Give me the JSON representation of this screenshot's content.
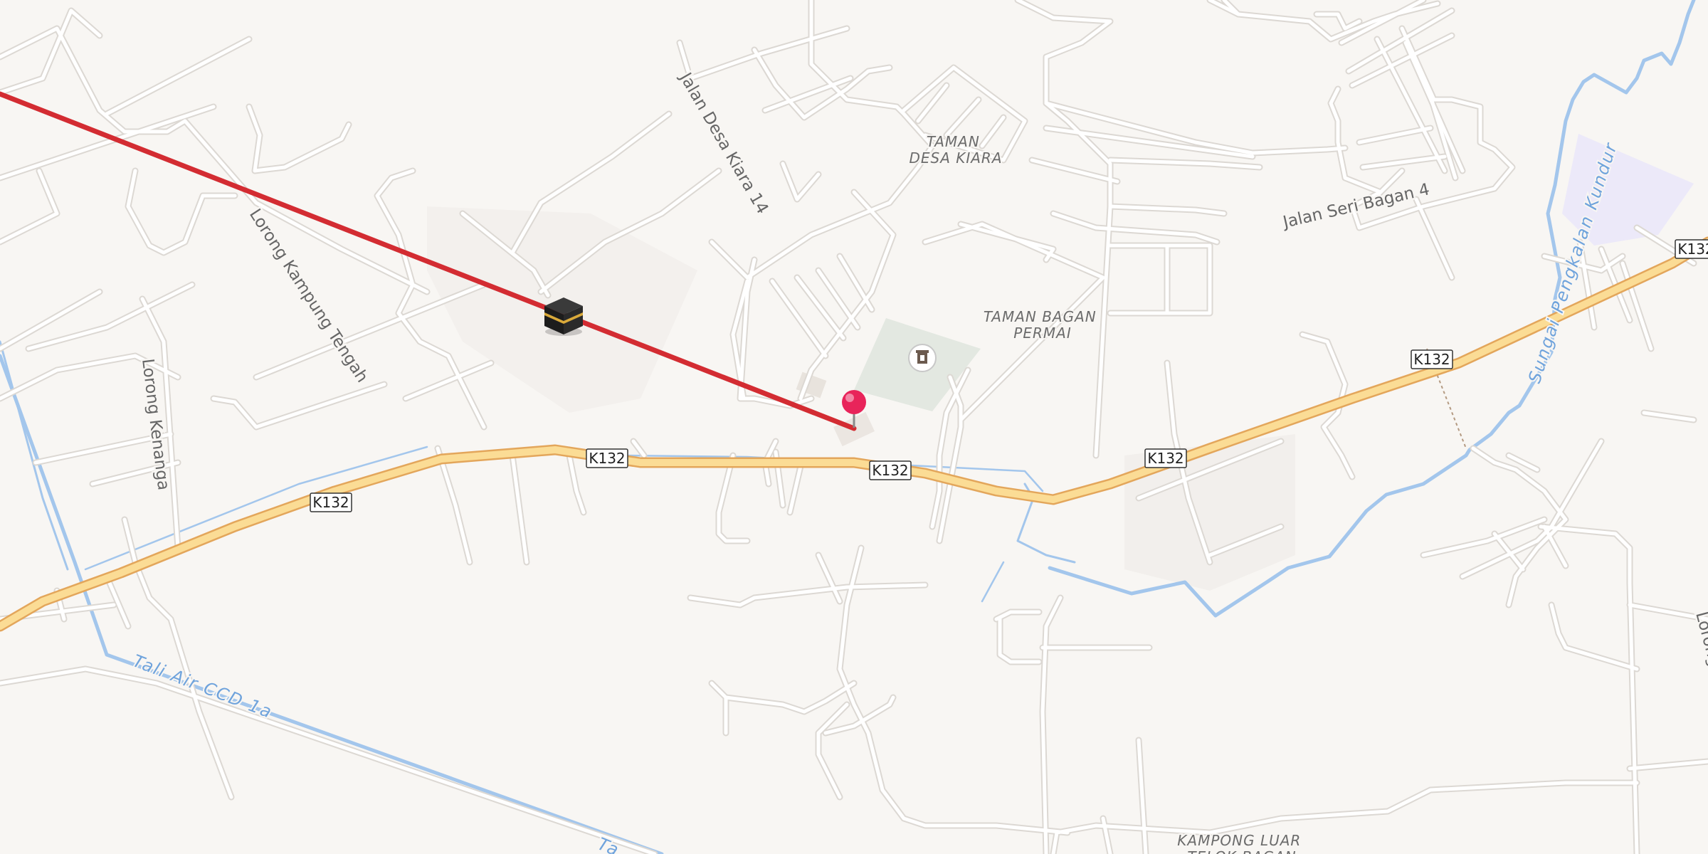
{
  "map": {
    "colors": {
      "background": "#f8f6f3",
      "route_line": "#d32c32",
      "highway": "#fbdc95",
      "water": "#a3c6ec",
      "pin": "#e8245a",
      "park": "#e3e8e1",
      "restricted_area": "#ece9f9"
    },
    "route_shields": [
      {
        "text": "K132"
      },
      {
        "text": "K132"
      },
      {
        "text": "K132"
      },
      {
        "text": "K132"
      },
      {
        "text": "K132"
      },
      {
        "text": "K132"
      }
    ],
    "street_labels": [
      {
        "text": "Jalan Desa Kiara 14"
      },
      {
        "text": "Lorong Kampung Tengah"
      },
      {
        "text": "Lorong Kenanga"
      },
      {
        "text": "Jalan Seri Bagan 4"
      },
      {
        "text": "Lorong"
      }
    ],
    "place_labels": [
      {
        "line1": "TAMAN",
        "line2": "DESA KIARA"
      },
      {
        "line1": "TAMAN BAGAN",
        "line2": "PERMAI"
      },
      {
        "line1": "KAMPONG LUAR",
        "line2": "TELOK BAGAN"
      }
    ],
    "water_labels": [
      {
        "text": "Tali Air CCD 1a"
      },
      {
        "text": "Sungai Pengkalan Kundur"
      },
      {
        "text": "Ta"
      }
    ],
    "markers": {
      "kaaba": {
        "icon": "kaaba-icon"
      },
      "poi": {
        "icon": "monument-icon"
      },
      "location_pin": {
        "icon": "map-pin-icon"
      }
    }
  }
}
